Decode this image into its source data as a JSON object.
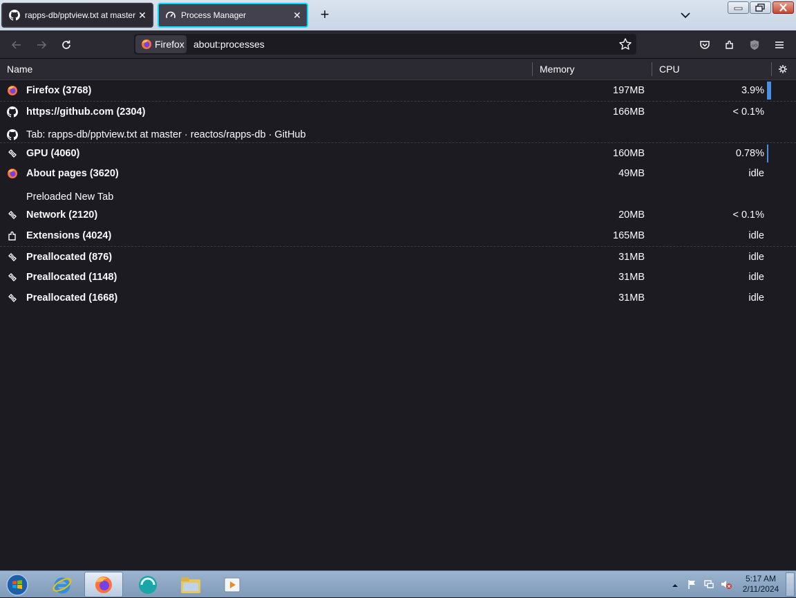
{
  "tabs": [
    {
      "label": "rapps-db/pptview.txt at master",
      "icon": "github-icon",
      "active": false
    },
    {
      "label": "Process Manager",
      "icon": "process-manager-icon",
      "active": true
    }
  ],
  "navbar": {
    "identity_label": "Firefox",
    "url": "about:processes"
  },
  "table": {
    "headers": {
      "name": "Name",
      "memory": "Memory",
      "cpu": "CPU"
    },
    "rows": [
      {
        "icon": "firefox-icon",
        "name": "Firefox (3768)",
        "memory": "197MB",
        "cpu": "3.9%",
        "cpu_load": 1.0,
        "type": "proc",
        "divider": false
      },
      {
        "icon": "github-icon",
        "name": "https://github.com (2304)",
        "memory": "166MB",
        "cpu": "< 0.1%",
        "cpu_load": 0,
        "type": "proc",
        "divider": true
      },
      {
        "icon": "github-icon",
        "name": "Tab: rapps-db/pptview.txt at master · reactos/rapps-db · GitHub",
        "memory": "",
        "cpu": "",
        "cpu_load": 0,
        "type": "tab",
        "divider": false
      },
      {
        "icon": "puzzle-link-icon",
        "name": "GPU (4060)",
        "memory": "160MB",
        "cpu": "0.78%",
        "cpu_load": 0.3,
        "type": "proc",
        "divider": true
      },
      {
        "icon": "firefox-icon",
        "name": "About pages (3620)",
        "memory": "49MB",
        "cpu": "idle",
        "cpu_load": 0,
        "type": "proc",
        "divider": false
      },
      {
        "icon": "",
        "name": "Preloaded New Tab",
        "memory": "",
        "cpu": "",
        "cpu_load": 0,
        "type": "tab",
        "divider": false
      },
      {
        "icon": "puzzle-link-icon",
        "name": "Network (2120)",
        "memory": "20MB",
        "cpu": "< 0.1%",
        "cpu_load": 0,
        "type": "proc",
        "divider": false
      },
      {
        "icon": "extension-icon",
        "name": "Extensions (4024)",
        "memory": "165MB",
        "cpu": "idle",
        "cpu_load": 0,
        "type": "proc",
        "divider": false
      },
      {
        "icon": "puzzle-link-icon",
        "name": "Preallocated (876)",
        "memory": "31MB",
        "cpu": "idle",
        "cpu_load": 0,
        "type": "proc",
        "divider": true
      },
      {
        "icon": "puzzle-link-icon",
        "name": "Preallocated (1148)",
        "memory": "31MB",
        "cpu": "idle",
        "cpu_load": 0,
        "type": "proc",
        "divider": false
      },
      {
        "icon": "puzzle-link-icon",
        "name": "Preallocated (1668)",
        "memory": "31MB",
        "cpu": "idle",
        "cpu_load": 0,
        "type": "proc",
        "divider": false
      }
    ]
  },
  "taskbar": {
    "items": [
      "start-orb-icon",
      "internet-explorer-icon",
      "firefox-icon",
      "app-icon",
      "folder-icon",
      "media-player-icon"
    ],
    "clock_time": "5:17 AM",
    "clock_date": "2/11/2024"
  },
  "colors": {
    "accent": "#00ddff",
    "cpu_bar": "#4a90e2",
    "page_bg": "#1c1b22"
  }
}
